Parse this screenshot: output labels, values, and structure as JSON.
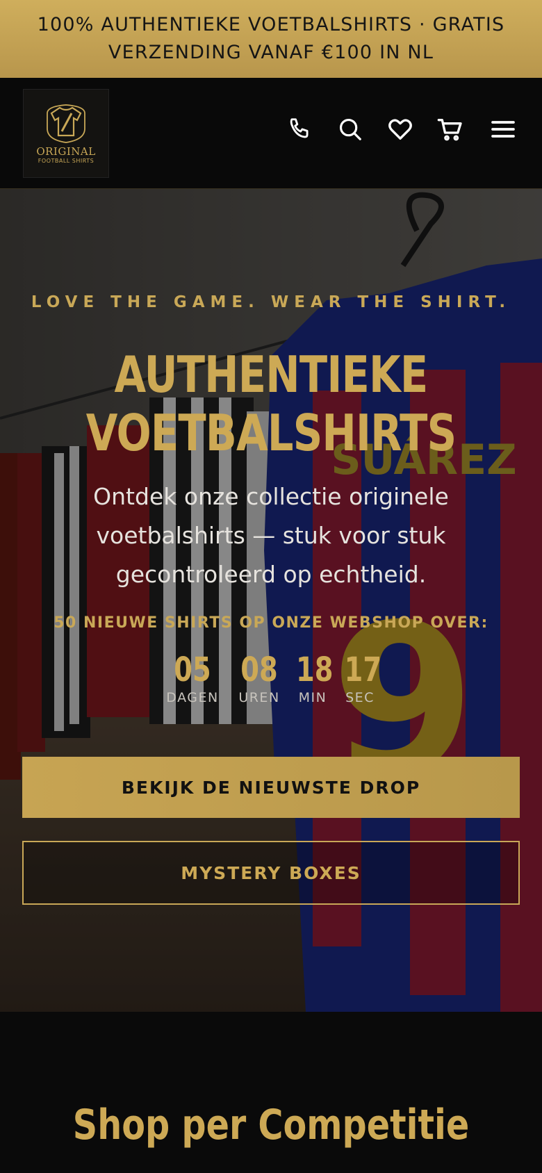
{
  "announcement": {
    "line1": "100% AUTHENTIEKE VOETBALSHIRTS · GRATIS",
    "line2": "VERZENDING VANAF €100 IN NL"
  },
  "header": {
    "logo": {
      "line1": "ORIGINAL",
      "line2": "FOOTBALL SHIRTS"
    },
    "icons": [
      "phone-icon",
      "search-icon",
      "heart-icon",
      "cart-icon",
      "menu-icon"
    ]
  },
  "hero": {
    "tagline": "LOVE THE GAME. WEAR THE SHIRT.",
    "title_line1": "AUTHENTIEKE",
    "title_line2": "VOETBALSHIRTS",
    "description": "Ontdek onze collectie originele voetbalshirts — stuk voor stuk gecontroleerd op echtheid.",
    "countdown_label": "50 NIEUWE SHIRTS OP ONZE WEBSHOP OVER:",
    "countdown": [
      {
        "value": "05",
        "unit": "DAGEN"
      },
      {
        "value": "08",
        "unit": "UREN"
      },
      {
        "value": "18",
        "unit": "MIN"
      },
      {
        "value": "17",
        "unit": "SEC"
      }
    ],
    "primary_button": "BEKIJK DE NIEUWSTE DROP",
    "secondary_button": "MYSTERY BOXES"
  },
  "section": {
    "heading": "Shop per Competitie"
  },
  "colors": {
    "gold": "#cda955",
    "background": "#0a0a0a",
    "text_light": "#e6e3de"
  }
}
